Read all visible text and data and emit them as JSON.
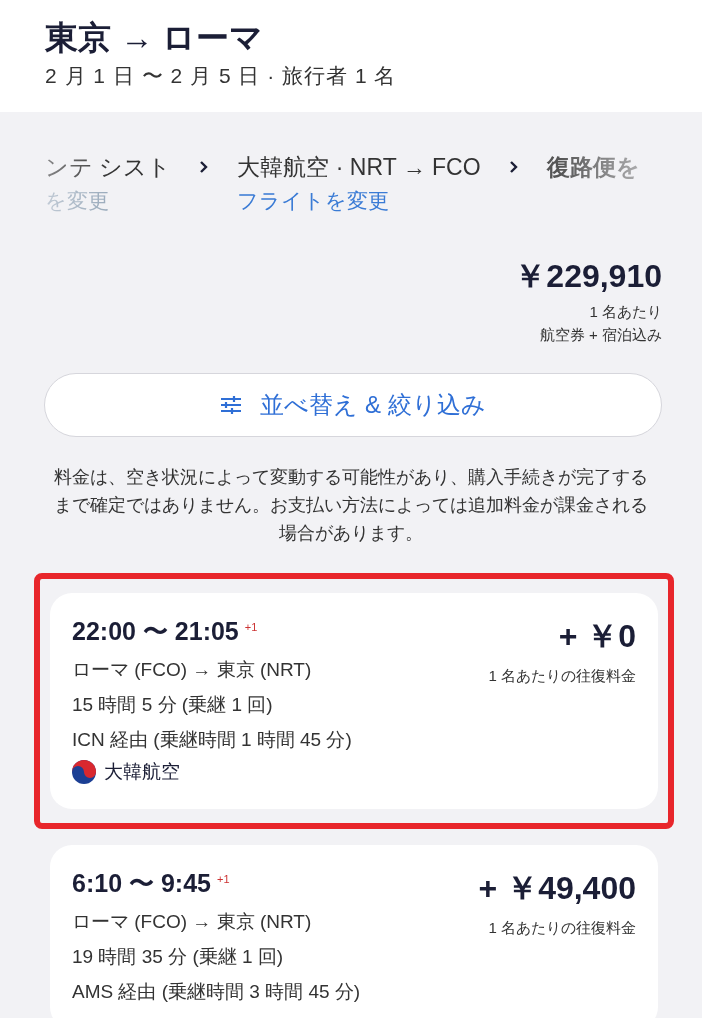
{
  "header": {
    "title": "東京 → ローマ",
    "subtitle": "2 月 1 日 〜 2 月 5 日 · 旅行者 1 名"
  },
  "breadcrumbs": [
    {
      "label": "ンテ シスト",
      "link": "を変更",
      "current": false
    },
    {
      "label": "大韓航空 · NRT → FCO",
      "link": "フライトを変更",
      "current": false
    },
    {
      "label": "復路便を",
      "current": true
    }
  ],
  "total": {
    "price": "￥229,910",
    "per_person": "1 名あたり",
    "includes": "航空券 + 宿泊込み"
  },
  "sort_button": "並べ替え & 絞り込み",
  "disclaimer": "料金は、空き状況によって変動する可能性があり、購入手続きが完了するまで確定ではありません。お支払い方法によっては追加料金が課金される場合があります。",
  "flights": [
    {
      "times": "22:00 〜 21:05",
      "day_offset": "+1",
      "route": "ローマ (FCO) → 東京 (NRT)",
      "duration": "15 時間 5 分 (乗継 1 回)",
      "via": "ICN 経由 (乗継時間 1 時間 45 分)",
      "airline": "大韓航空",
      "price": "+ ￥0",
      "price_note": "1 名あたりの往復料金",
      "highlighted": true
    },
    {
      "times": "6:10 〜 9:45",
      "day_offset": "+1",
      "route": "ローマ (FCO) → 東京 (NRT)",
      "duration": "19 時間 35 分 (乗継 1 回)",
      "via": "AMS 経由 (乗継時間 3 時間 45 分)",
      "price": "+ ￥49,400",
      "price_note": "1 名あたりの往復料金",
      "highlighted": false
    }
  ]
}
